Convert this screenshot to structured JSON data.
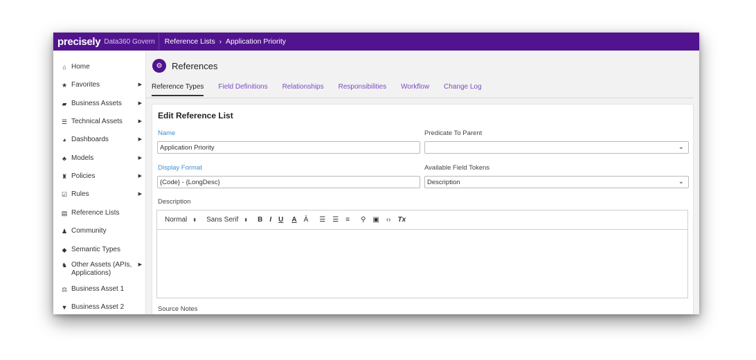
{
  "header": {
    "brand": "precisely",
    "product": "Data360 Govern",
    "breadcrumb": [
      "Reference Lists",
      "Application Priority"
    ],
    "breadcrumb_separator": "›"
  },
  "sidebar": {
    "items": [
      {
        "label": "Home",
        "icon": "home-icon",
        "glyph": "⌂",
        "has_submenu": false
      },
      {
        "label": "Favorites",
        "icon": "star-icon",
        "glyph": "★",
        "has_submenu": true
      },
      {
        "label": "Business Assets",
        "icon": "book-icon",
        "glyph": "▰",
        "has_submenu": true
      },
      {
        "label": "Technical Assets",
        "icon": "database-icon",
        "glyph": "☰",
        "has_submenu": true
      },
      {
        "label": "Dashboards",
        "icon": "dashboard-icon",
        "glyph": "◕",
        "has_submenu": true
      },
      {
        "label": "Models",
        "icon": "sitemap-icon",
        "glyph": "♣",
        "has_submenu": true
      },
      {
        "label": "Policies",
        "icon": "institution-icon",
        "glyph": "♜",
        "has_submenu": true
      },
      {
        "label": "Rules",
        "icon": "checkbox-icon",
        "glyph": "☑",
        "has_submenu": true
      },
      {
        "label": "Reference Lists",
        "icon": "list-icon",
        "glyph": "▤",
        "has_submenu": false
      },
      {
        "label": "Community",
        "icon": "users-icon",
        "glyph": "♟",
        "has_submenu": false
      },
      {
        "label": "Semantic Types",
        "icon": "tags-icon",
        "glyph": "◆",
        "has_submenu": false
      },
      {
        "label": "Other Assets (APIs, Applications)",
        "icon": "binoculars-icon",
        "glyph": "♞",
        "has_submenu": true
      },
      {
        "label": "Business Asset 1",
        "icon": "balance-scale-icon",
        "glyph": "⚖",
        "has_submenu": false
      },
      {
        "label": "Business Asset 2",
        "icon": "filter-icon",
        "glyph": "▼",
        "has_submenu": false
      }
    ],
    "submenu_glyph": "▶"
  },
  "main": {
    "section_title": "References",
    "section_icon_glyph": "⚙",
    "tabs": [
      {
        "label": "Reference Types",
        "active": true
      },
      {
        "label": "Field Definitions",
        "active": false
      },
      {
        "label": "Relationships",
        "active": false
      },
      {
        "label": "Responsibilities",
        "active": false
      },
      {
        "label": "Workflow",
        "active": false
      },
      {
        "label": "Change Log",
        "active": false
      }
    ]
  },
  "form": {
    "title": "Edit Reference List",
    "name_label": "Name",
    "name_value": "Application Priority",
    "predicate_label": "Predicate To Parent",
    "predicate_value": "",
    "display_format_label": "Display Format",
    "display_format_value": "{Code} - {LongDesc}",
    "tokens_label": "Available Field Tokens",
    "tokens_value": "Description",
    "description_label": "Description",
    "source_notes_label": "Source Notes",
    "dropdown_glyph": "⌄"
  },
  "editor": {
    "format_value": "Normal",
    "font_value": "Sans Serif",
    "updown_glyph": "⬍",
    "buttons": [
      {
        "name": "bold-button",
        "glyph": "B",
        "cls": "bold"
      },
      {
        "name": "italic-button",
        "glyph": "I",
        "cls": "ital"
      },
      {
        "name": "underline-button",
        "glyph": "U",
        "cls": "under"
      },
      {
        "name": "text-color-button",
        "glyph": "A",
        "cls": "under"
      },
      {
        "name": "highlight-button",
        "glyph": "Ā",
        "cls": ""
      },
      {
        "name": "ordered-list-button",
        "glyph": "☰",
        "cls": ""
      },
      {
        "name": "bullet-list-button",
        "glyph": "☰",
        "cls": ""
      },
      {
        "name": "align-button",
        "glyph": "≡",
        "cls": ""
      },
      {
        "name": "link-button",
        "glyph": "⚲",
        "cls": ""
      },
      {
        "name": "image-button",
        "glyph": "▣",
        "cls": ""
      },
      {
        "name": "code-button",
        "glyph": "‹›",
        "cls": ""
      },
      {
        "name": "clear-format-button",
        "glyph": "Tx",
        "cls": "ital"
      }
    ]
  },
  "colors": {
    "header_bg": "#51148e",
    "tab_link": "#7c4bc2",
    "label_blue": "#3a8fd6"
  }
}
